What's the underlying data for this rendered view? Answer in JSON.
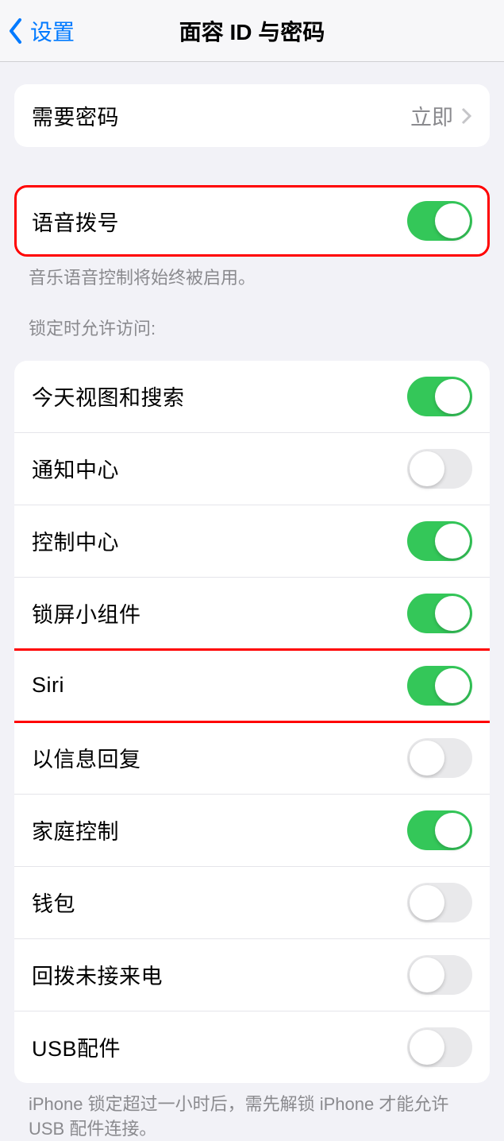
{
  "nav": {
    "back": "设置",
    "title": "面容 ID 与密码"
  },
  "passcode": {
    "label": "需要密码",
    "value": "立即"
  },
  "voice": {
    "label": "语音拨号",
    "on": true,
    "footer": "音乐语音控制将始终被启用。"
  },
  "lockAccessHeader": "锁定时允许访问:",
  "lockAccess": [
    {
      "label": "今天视图和搜索",
      "on": true
    },
    {
      "label": "通知中心",
      "on": false
    },
    {
      "label": "控制中心",
      "on": true
    },
    {
      "label": "锁屏小组件",
      "on": true
    },
    {
      "label": "Siri",
      "on": true,
      "highlight": true
    },
    {
      "label": "以信息回复",
      "on": false
    },
    {
      "label": "家庭控制",
      "on": true
    },
    {
      "label": "钱包",
      "on": false
    },
    {
      "label": "回拨未接来电",
      "on": false
    },
    {
      "label": "USB配件",
      "on": false
    }
  ],
  "usbFooter": "iPhone 锁定超过一小时后，需先解锁 iPhone 才能允许 USB 配件连接。"
}
